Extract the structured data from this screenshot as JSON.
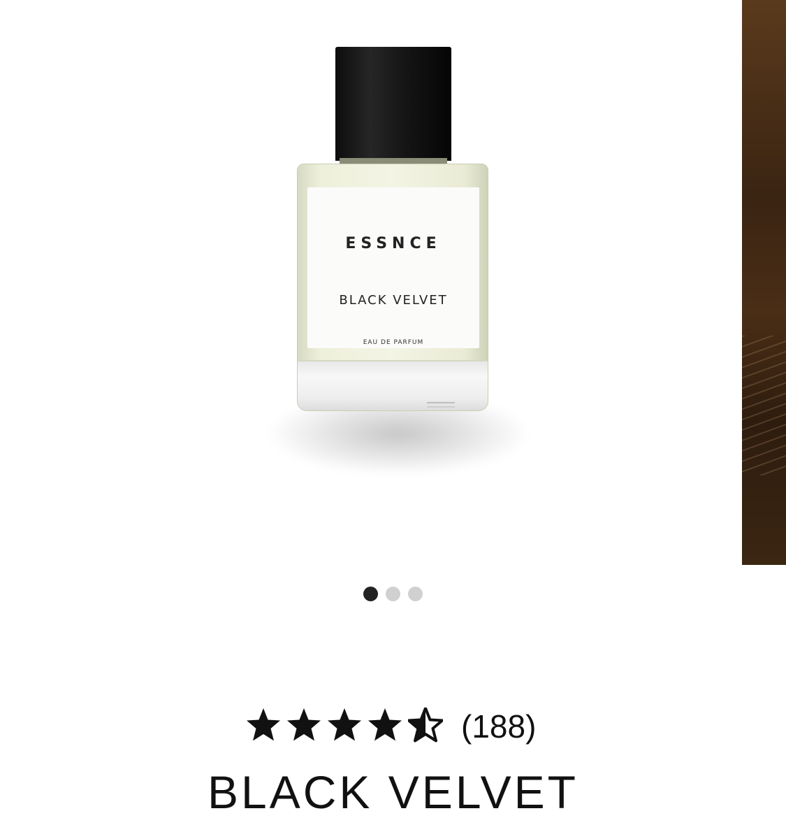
{
  "gallery": {
    "bottle_label": {
      "brand": "ESSNCE",
      "product": "BLACK VELVET",
      "type": "EAU DE PARFUM"
    },
    "dots": [
      {
        "active": true
      },
      {
        "active": false
      },
      {
        "active": false
      }
    ]
  },
  "product": {
    "rating": 4.5,
    "rating_max": 5,
    "review_count": "(188)",
    "title": "BLACK VELVET"
  },
  "colors": {
    "star": "#111111",
    "dot_active": "#222222",
    "dot_inactive": "#d0d0d0"
  }
}
